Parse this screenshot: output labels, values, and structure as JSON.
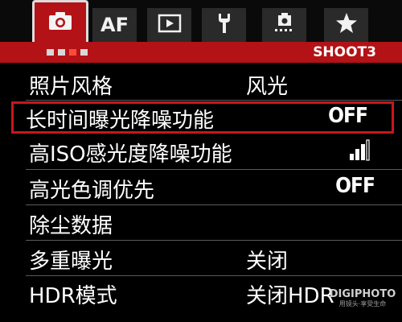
{
  "tabs": [
    {
      "icon": "camera-icon",
      "active": true
    },
    {
      "label": "AF",
      "icon": "",
      "active": false
    },
    {
      "icon": "playback-icon",
      "active": false
    },
    {
      "icon": "wrench-icon",
      "active": false
    },
    {
      "icon": "custom-function-icon",
      "active": false
    },
    {
      "icon": "star-icon",
      "active": false
    }
  ],
  "header": {
    "page_label": "SHOOT3",
    "page_dots": 4,
    "active_dot": 3
  },
  "menu": {
    "items": [
      {
        "label": "照片风格",
        "value": "风光",
        "value_align": "left",
        "selected": false
      },
      {
        "label": "长时间曝光降噪功能",
        "value": "OFF",
        "value_align": "right",
        "selected": true
      },
      {
        "label": "高ISO感光度降噪功能",
        "value": "",
        "value_icon": "noise-reduction-level-icon",
        "level": "3/4",
        "value_align": "right",
        "selected": false
      },
      {
        "label": "高光色调优先",
        "value": "OFF",
        "value_align": "right",
        "selected": false
      },
      {
        "label": "除尘数据",
        "value": "",
        "value_align": "left",
        "selected": false
      },
      {
        "label": "多重曝光",
        "value": "关闭",
        "value_align": "left",
        "selected": false
      },
      {
        "label": "HDR模式",
        "value": "关闭HDR",
        "value_align": "left",
        "selected": false
      }
    ]
  },
  "watermark": {
    "brand": "DIGIPHOTO",
    "tagline": "用镜头·享受生命"
  },
  "colors": {
    "accent": "#b31216",
    "selection": "#c8161b",
    "background": "#000000",
    "text": "#ffffff"
  }
}
